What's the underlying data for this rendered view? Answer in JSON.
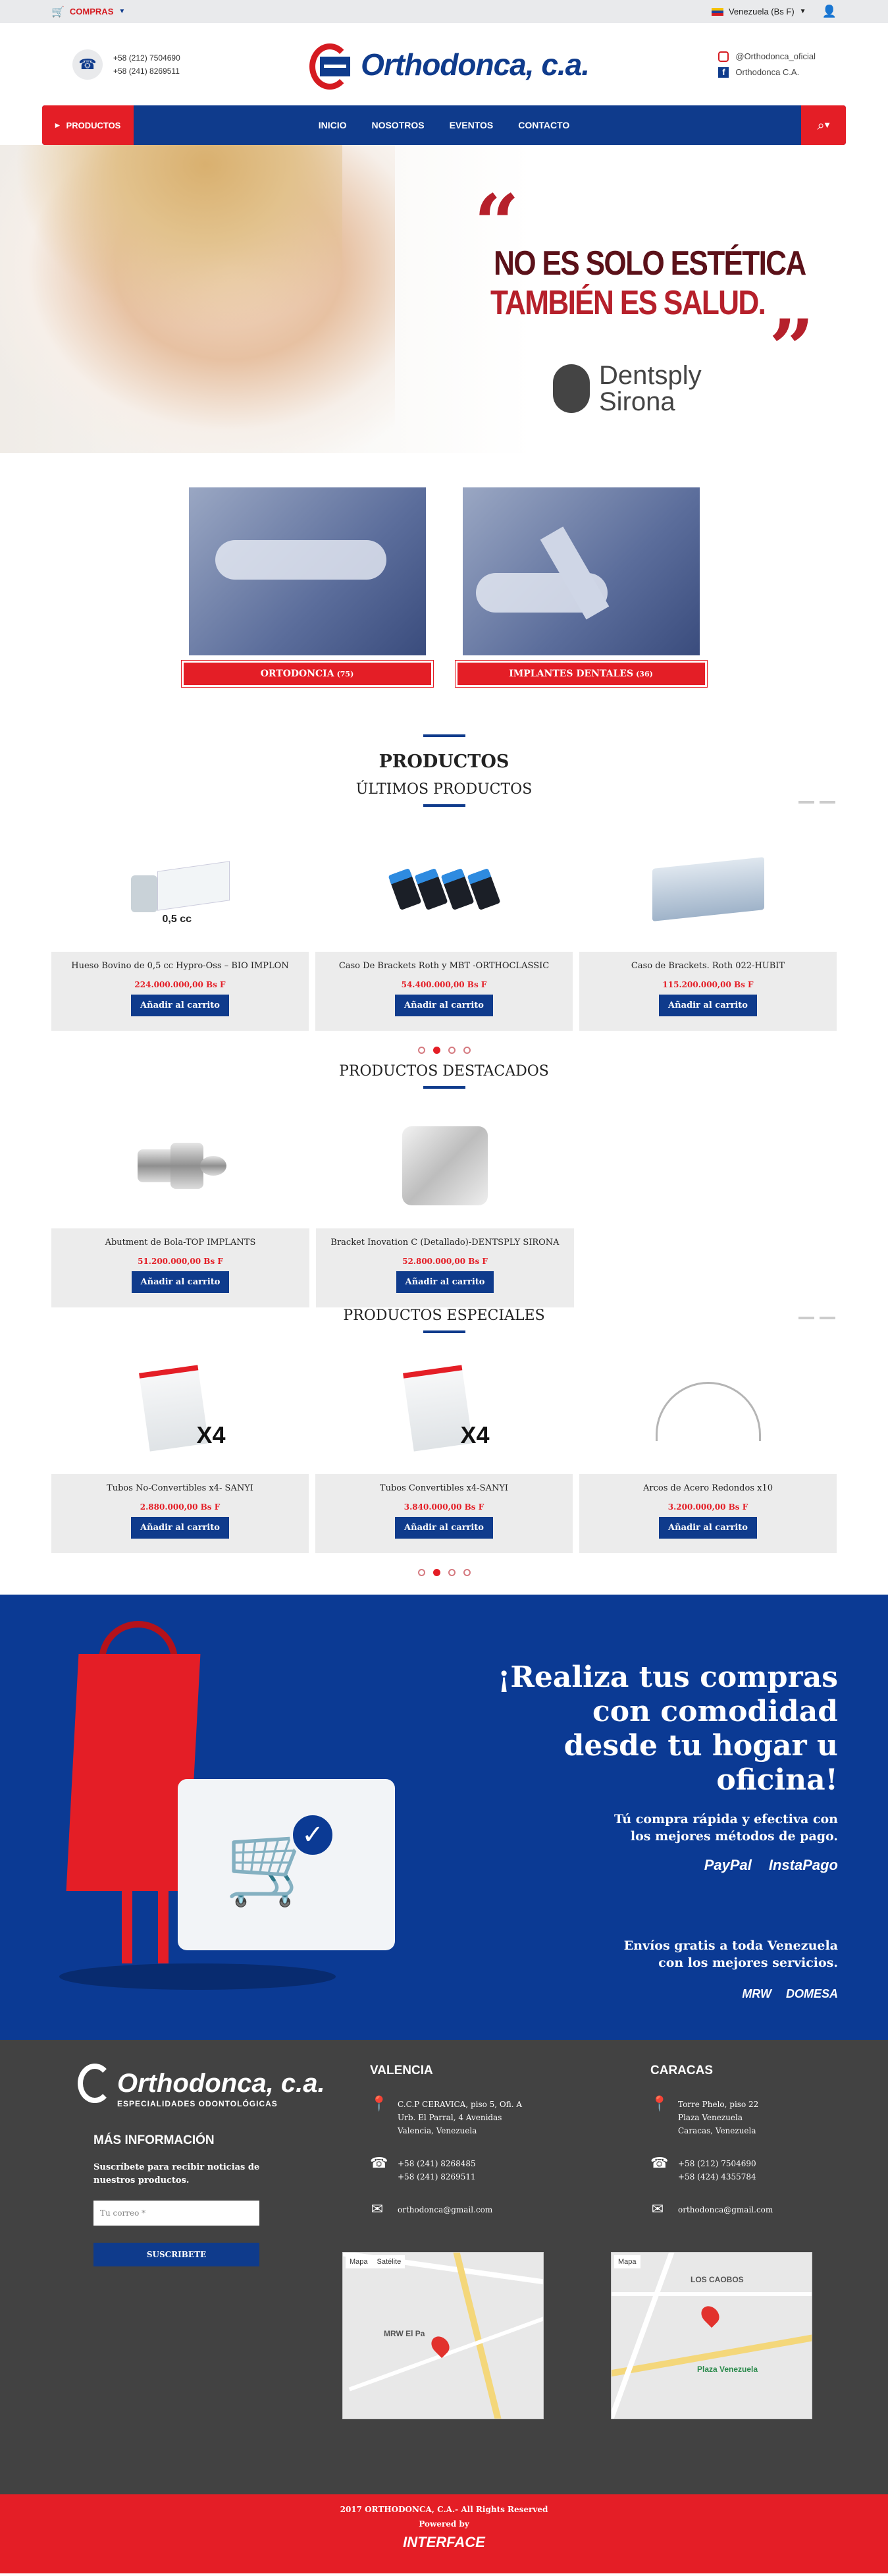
{
  "topbar": {
    "cart_label": "COMPRAS",
    "country": "Venezuela (Bs F)"
  },
  "header": {
    "phones": [
      "+58 (212) 7504690",
      "+58 (241) 8269511"
    ],
    "logo_text": "Orthodonca, c.a.",
    "instagram": "@Orthodonca_oficial",
    "facebook": "Orthodonca C.A."
  },
  "nav": {
    "products": "PRODUCTOS",
    "links": [
      "INICIO",
      "NOSOTROS",
      "EVENTOS",
      "CONTACTO"
    ]
  },
  "hero": {
    "line1": "NO ES SOLO ESTÉTICA",
    "line2": "TAMBIÉN ES SALUD.",
    "brand_1": "Dentsply",
    "brand_2": "Sirona"
  },
  "categories": [
    {
      "label": "ORTODONCIA",
      "count": "(75)"
    },
    {
      "label": "IMPLANTES DENTALES",
      "count": "(36)"
    }
  ],
  "sections": {
    "productos": "PRODUCTOS",
    "ultimos": "ÚLTIMOS PRODUCTOS",
    "destacados": "PRODUCTOS DESTACADOS",
    "especiales": "PRODUCTOS ESPECIALES"
  },
  "cart_button": "Añadir al carrito",
  "latest": [
    {
      "title": "Hueso Bovino de 0,5 cc Hypro-Oss – BIO IMPLON",
      "price": "224.000.000,00 Bs F",
      "pic_label": "0,5 cc"
    },
    {
      "title": "Caso De Brackets Roth y MBT -ORTHOCLASSIC",
      "price": "54.400.000,00 Bs F"
    },
    {
      "title": "Caso de Brackets. Roth 022-HUBIT",
      "price": "115.200.000,00 Bs F"
    }
  ],
  "featured": [
    {
      "title": "Abutment de Bola-TOP IMPLANTS",
      "price": "51.200.000,00 Bs F"
    },
    {
      "title": "Bracket Inovation C (Detallado)-DENTSPLY SIRONA",
      "price": "52.800.000,00 Bs F"
    }
  ],
  "special": [
    {
      "title": "Tubos No-Convertibles x4- SANYI",
      "price": "2.880.000,00 Bs F",
      "pic_label": "X4"
    },
    {
      "title": "Tubos Convertibles x4-SANYI",
      "price": "3.840.000,00 Bs F",
      "pic_label": "X4"
    },
    {
      "title": "Arcos de Acero Redondos x10",
      "price": "3.200.000,00 Bs F"
    }
  ],
  "banner": {
    "headline": "¡Realiza tus compras con comodidad desde tu hogar u oficina!",
    "sub1": "Tú compra rápida y efectiva con",
    "sub2": "los mejores métodos de pago.",
    "pay1": "PayPal",
    "pay2": "InstaPago",
    "ship1": "Envíos gratis a toda Venezuela",
    "ship2": "con los mejores servicios.",
    "carrier1": "MRW",
    "carrier2": "DOMESA"
  },
  "footer": {
    "logo_text": "Orthodonca, c.a.",
    "tagline": "ESPECIALIDADES ODONTOLÓGICAS",
    "more_info": "MÁS INFORMACIÓN",
    "subscribe_text_1": "Suscríbete para recibir noticias de",
    "subscribe_text_2": "nuestros productos.",
    "email_placeholder": "Tu correo *",
    "subscribe_btn": "SUSCRIBETE",
    "valencia": {
      "title": "VALENCIA",
      "addr": [
        "C.C.P CERAVICA, piso 5, Ofi. A",
        "Urb. El Parral, 4 Avenidas",
        "Valencia, Venezuela"
      ],
      "phones": [
        "+58 (241) 8268485",
        "+58 (241) 8269511"
      ],
      "email": "orthodonca@gmail.com"
    },
    "caracas": {
      "title": "CARACAS",
      "addr": [
        "Torre Phelo, piso 22",
        "Plaza Venezuela",
        "Caracas, Venezuela"
      ],
      "phones": [
        "+58 (212) 7504690",
        "+58 (424) 4355784"
      ],
      "email": "orthodonca@gmail.com"
    },
    "map_tab1": "Mapa",
    "map_tab2": "Satélite",
    "map1_label": "MRW El Pa",
    "map2_label1": "LOS CAOBOS",
    "map2_label2": "Plaza Venezuela"
  },
  "bottom": {
    "copyright": "2017 ORTHODONCA, C.A.- All Rights Reserved",
    "powered": "Powered by",
    "agency": "INTERFACE"
  }
}
